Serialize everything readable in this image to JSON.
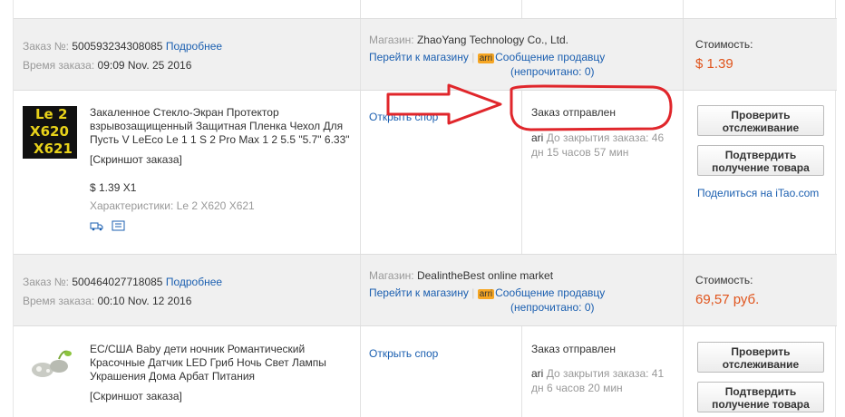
{
  "orders": [
    {
      "order_label": "Заказ №:",
      "order_number": "500593234308085",
      "details_link": "Подробнее",
      "time_label": "Время заказа:",
      "time_value": "09:09 Nov. 25 2016",
      "store_label": "Магазин:",
      "store_name": "ZhaoYang Technology Co., Ltd.",
      "goto_store": "Перейти к магазину",
      "chat_badge": "arri",
      "message_seller": "Сообщение продавцу",
      "unread": "(непрочитано: 0)",
      "cost_label": "Стоимость:",
      "cost_value": "$ 1.39",
      "thumb_lines": [
        "Le 2",
        "X620",
        "X621"
      ],
      "product_title": "Закаленное Стекло-Экран Протектор взрывозащищенный Защитная Пленка Чехол Для Пусть V LeEco Le 1 1 S 2 Pro Max 1 2 5.5 \"5.7\" 6.33\"",
      "snapshot": "[Скриншот заказа]",
      "item_price": "$ 1.39 X1",
      "characteristics": "Характеристики: Le 2 X620 X621",
      "dispute": "Открыть спор",
      "status": "Заказ отправлен",
      "countdown_icon": "ari",
      "countdown": "До закрытия заказа: 46 дн 15 часов 57 мин",
      "btn_track": "Проверить отслеживание",
      "btn_confirm": "Подтвердить получение товара",
      "share_prefix": "Поделиться на ",
      "share_brand": "iTao.com"
    },
    {
      "order_label": "Заказ №:",
      "order_number": "500464027718085",
      "details_link": "Подробнее",
      "time_label": "Время заказа:",
      "time_value": "00:10 Nov. 12 2016",
      "store_label": "Магазин:",
      "store_name": "DealintheBest online market",
      "goto_store": "Перейти к магазину",
      "chat_badge": "arri",
      "message_seller": "Сообщение продавцу",
      "unread": "(непрочитано: 0)",
      "cost_label": "Стоимость:",
      "cost_value": "69,57 руб.",
      "product_title": "ЕС/США Baby дети ночник Романтический Красочные Датчик LED Гриб Ночь Свет Лампы Украшения Дома Арбат Питания",
      "snapshot": "[Скриншот заказа]",
      "dispute": "Открыть спор",
      "status": "Заказ отправлен",
      "countdown_icon": "ari",
      "countdown": "До закрытия заказа: 41 дн 6 часов 20 мин",
      "btn_track": "Проверить отслеживание",
      "btn_confirm": "Подтвердить получение товара"
    }
  ],
  "colors": {
    "link": "#1b5fb0",
    "price": "#e0541c",
    "annotation": "#e0262b"
  }
}
